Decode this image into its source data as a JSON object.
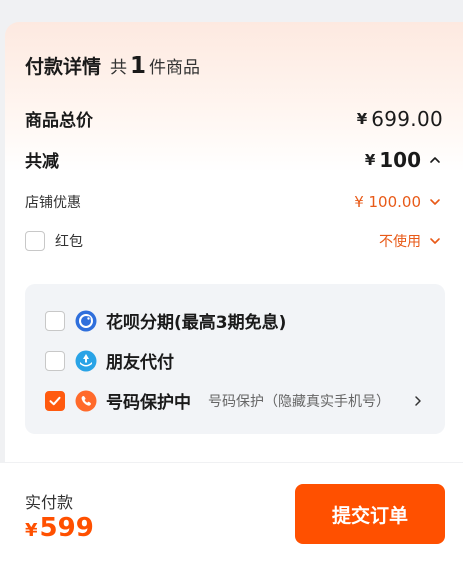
{
  "header": {
    "title": "付款详情",
    "count_prefix": "共",
    "count": "1",
    "count_suffix": "件商品"
  },
  "summary": {
    "goods_total_label": "商品总价",
    "goods_total_currency": "¥",
    "goods_total_value": "699.00",
    "discount_label": "共减",
    "discount_currency": "¥",
    "discount_value": "100",
    "shop_coupon_label": "店铺优惠",
    "shop_coupon_value": "¥ 100.00",
    "red_packet_label": "红包",
    "red_packet_value": "不使用"
  },
  "payment_options": [
    {
      "label": "花呗分期(最高3期免息)",
      "checked": false,
      "icon": "huabei-icon"
    },
    {
      "label": "朋友代付",
      "checked": false,
      "icon": "friend-pay-icon"
    },
    {
      "label": "号码保护中",
      "desc": "号码保护（隐藏真实手机号）",
      "checked": true,
      "icon": "phone-protect-icon"
    }
  ],
  "footer": {
    "actual_label": "实付款",
    "currency": "¥",
    "total": "599",
    "submit_label": "提交订单"
  },
  "colors": {
    "accent": "#ff5000",
    "discount_orange": "#e85a18",
    "huabei_blue": "#2f6fdc",
    "friend_blue": "#29a3e6"
  }
}
